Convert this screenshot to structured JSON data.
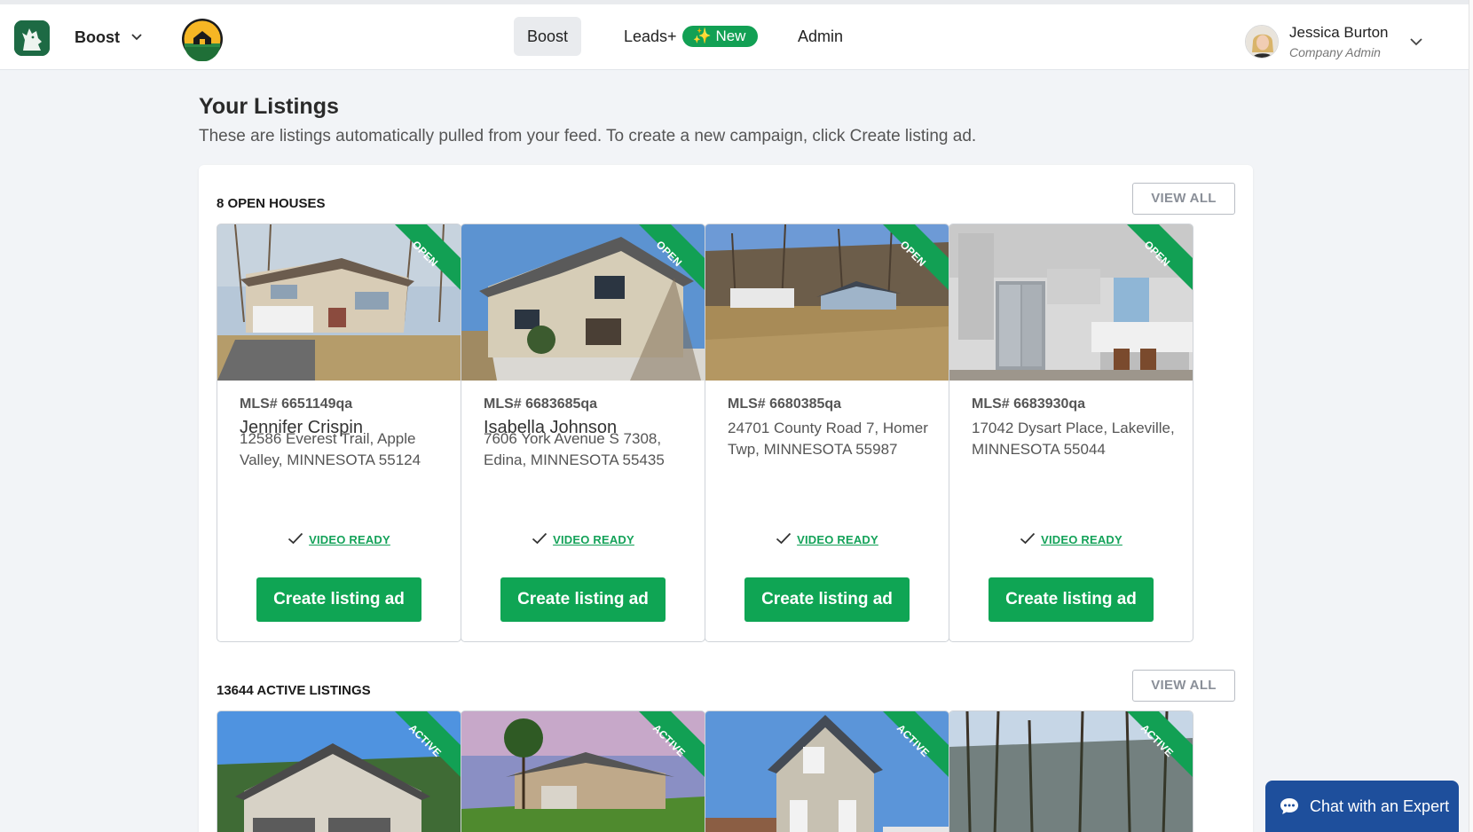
{
  "nav": {
    "app_name": "Boost",
    "tabs": [
      {
        "label": "Boost",
        "active": true
      },
      {
        "label": "Leads+",
        "badge": "✨ New"
      },
      {
        "label": "Admin"
      }
    ],
    "user": {
      "name": "Jessica Burton",
      "role": "Company Admin"
    }
  },
  "page": {
    "title": "Your Listings",
    "description": "These are listings automatically pulled from your feed. To create a new campaign, click Create listing ad."
  },
  "sections": [
    {
      "title": "8 OPEN HOUSES",
      "view_all": "VIEW ALL",
      "ribbon": "OPEN",
      "cards": [
        {
          "mls": "MLS# 6651149qa",
          "agent": "Jennifer Crispin",
          "address": "12586 Everest Trail, Apple Valley, MINNESOTA 55124",
          "status": "VIDEO READY",
          "cta": "Create listing ad"
        },
        {
          "mls": "MLS# 6683685qa",
          "agent": "Isabella Johnson",
          "address": "7606 York Avenue S 7308, Edina, MINNESOTA 55435",
          "status": "VIDEO READY",
          "cta": "Create listing ad"
        },
        {
          "mls": "MLS# 6680385qa",
          "agent": "",
          "address": "24701 County Road 7, Homer Twp, MINNESOTA 55987",
          "status": "VIDEO READY",
          "cta": "Create listing ad"
        },
        {
          "mls": "MLS# 6683930qa",
          "agent": "",
          "address": "17042 Dysart Place, Lakeville, MINNESOTA 55044",
          "status": "VIDEO READY",
          "cta": "Create listing ad"
        }
      ]
    },
    {
      "title": "13644 ACTIVE LISTINGS",
      "view_all": "VIEW ALL",
      "ribbon": "ACTIVE"
    }
  ],
  "chat": {
    "label": "Chat with an Expert"
  },
  "colors": {
    "accent_green": "#0fa554",
    "brand_dark_green": "#1d6a44",
    "chat_blue": "#1e4f9c"
  },
  "icons": [
    "wolf-logo-icon",
    "chevron-down-icon",
    "house-logo-icon",
    "check-icon",
    "chat-bubble-icon"
  ]
}
